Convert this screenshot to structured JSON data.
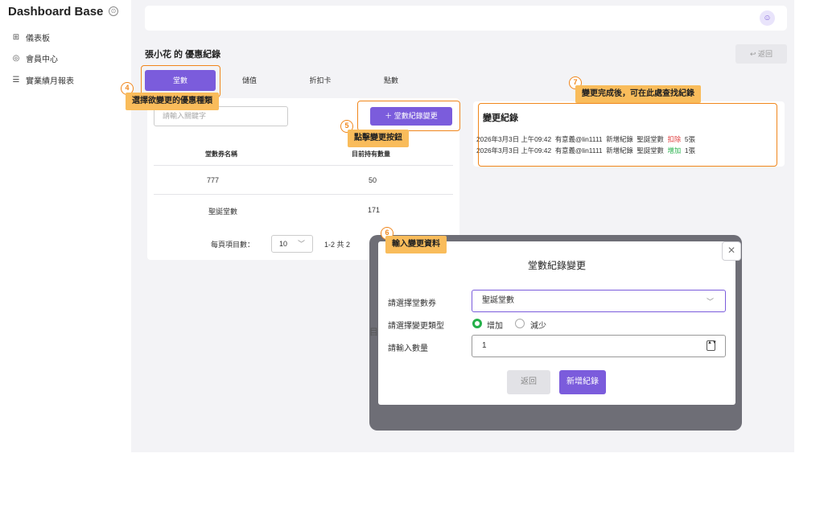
{
  "sidebar": {
    "brand": "Dashboard Base",
    "toggle_icon": "⊙",
    "items": [
      {
        "icon": "grid-icon",
        "glyph": "⊞",
        "label": "儀表板"
      },
      {
        "icon": "user-circle-icon",
        "glyph": "◎",
        "label": "會員中心"
      },
      {
        "icon": "list-icon",
        "glyph": "☰",
        "label": "實業績月報表"
      }
    ]
  },
  "header": {
    "avatar_glyph": "☺"
  },
  "page": {
    "title": "張小花 的 優惠紀錄",
    "back_label": "↩ 返回"
  },
  "tabs": [
    {
      "label": "堂數",
      "active": true
    },
    {
      "label": "儲值",
      "active": false
    },
    {
      "label": "折扣卡",
      "active": false
    },
    {
      "label": "點數",
      "active": false
    }
  ],
  "coupons": {
    "search_placeholder": "請輸入關鍵字",
    "change_button": "＋ 堂數紀錄變更",
    "columns": [
      "堂數券名稱",
      "目前持有數量"
    ],
    "rows": [
      {
        "name": "777",
        "qty": "50"
      },
      {
        "name": "聖誕堂數",
        "qty": "171"
      }
    ],
    "pager": {
      "label": "每頁項目數：",
      "page_size": "10",
      "chevron": "﹀",
      "range": "1-2 共 2"
    }
  },
  "history": {
    "title": "變更紀錄",
    "entries": [
      {
        "date": "2026年3月3日 上午09:42",
        "user": "有意義@lin1111",
        "type": "新增紀錄",
        "item": "聖誕堂數",
        "action": "扣除",
        "action_color": "red",
        "amount": "5張"
      },
      {
        "date": "2026年3月3日 上午09:42",
        "user": "有意義@lin1111",
        "type": "新增紀錄",
        "item": "聖誕堂數",
        "action": "增加",
        "action_color": "green",
        "amount": "1張"
      }
    ]
  },
  "modal": {
    "title": "堂數紀錄變更",
    "close_glyph": "✕",
    "behind_text": "目",
    "coupon_label": "請選擇堂數券",
    "coupon_value": "聖誕堂數",
    "coupon_chevron": "﹀",
    "type_label": "請選擇變更類型",
    "type_options": [
      "增加",
      "減少"
    ],
    "type_selected": "增加",
    "qty_label": "請輸入數量",
    "qty_value": "1",
    "qty_spin": "▲▼",
    "back_button": "返回",
    "submit_button": "新增紀錄"
  },
  "annotations": {
    "step4": {
      "num": "4",
      "text": "選擇欲變更的優惠種類"
    },
    "step5": {
      "num": "5",
      "text": "點擊變更按鈕"
    },
    "step6": {
      "num": "6",
      "text": "輸入變更資料"
    },
    "step7": {
      "num": "7",
      "text": "變更完成後，可在此處查找紀錄"
    }
  },
  "colors": {
    "accent": "#7b5cdc",
    "highlight": "#f0861b",
    "note_bg": "#f9bc5b",
    "increase": "#25b04a",
    "decrease": "#e04040"
  }
}
